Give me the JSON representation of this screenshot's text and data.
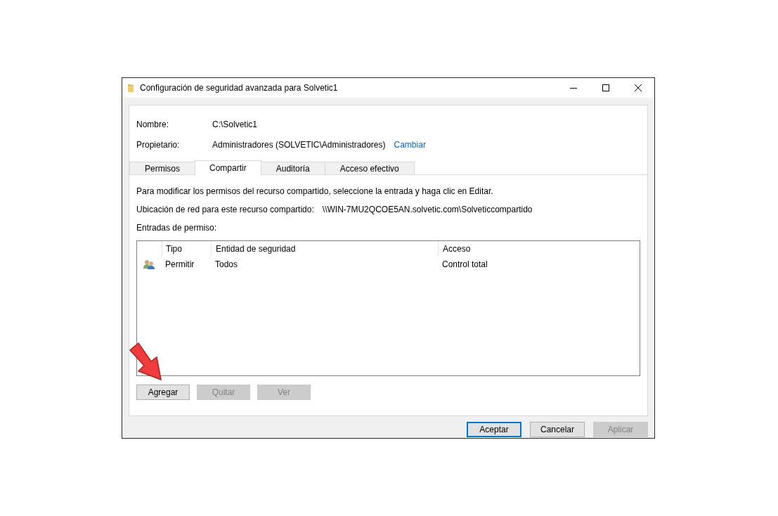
{
  "window": {
    "title": "Configuración de seguridad avanzada para Solvetic1"
  },
  "fields": [
    {
      "label": "Nombre:",
      "value": "C:\\Solvetic1"
    },
    {
      "label": "Propietario:",
      "value": "Administradores (SOLVETIC\\Administradores)",
      "link": "Cambiar"
    }
  ],
  "tabs": [
    {
      "label": "Permisos",
      "selected": false
    },
    {
      "label": "Compartir",
      "selected": true
    },
    {
      "label": "Auditoría",
      "selected": false
    },
    {
      "label": "Acceso efectivo",
      "selected": false
    }
  ],
  "instructions": "Para modificar los permisos del recurso compartido, seleccione la entrada y haga clic en Editar.",
  "network_location": {
    "label": "Ubicación de red para este recurso compartido:",
    "value": "\\\\WIN-7MU2QCOE5AN.solvetic.com\\Solveticcompartido"
  },
  "entries_label": "Entradas de permiso:",
  "table": {
    "columns": [
      "Tipo",
      "Entidad de seguridad",
      "Acceso"
    ],
    "rows": [
      {
        "cells": [
          "Permitir",
          "Todos",
          "Control total"
        ]
      }
    ]
  },
  "entry_buttons": [
    {
      "label": "Agregar",
      "disabled": false
    },
    {
      "label": "Quitar",
      "disabled": true
    },
    {
      "label": "Ver",
      "disabled": true
    }
  ],
  "dialog_buttons": [
    {
      "label": "Aceptar",
      "disabled": false,
      "focused": true
    },
    {
      "label": "Cancelar",
      "disabled": false,
      "focused": false
    },
    {
      "label": "Aplicar",
      "disabled": true,
      "focused": false
    }
  ]
}
